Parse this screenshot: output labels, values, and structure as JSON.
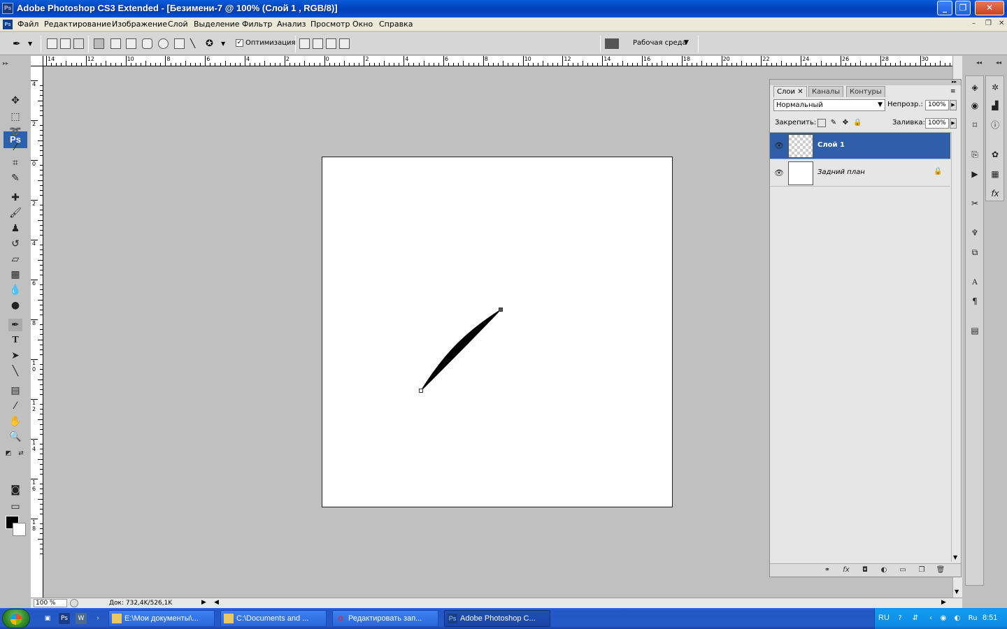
{
  "window": {
    "title": "Adobe Photoshop CS3 Extended - [Безимени-7 @ 100% (Слой 1 , RGB/8)]",
    "app_badge": "Ps"
  },
  "menu": {
    "items": [
      "Файл",
      "Редактирование",
      "Изображение",
      "Слой",
      "Выделение",
      "Фильтр",
      "Анализ",
      "Просмотр",
      "Окно",
      "Справка"
    ]
  },
  "options_bar": {
    "optimize_checked": true,
    "optimize_label": "Оптимизация",
    "workspace_label": "Рабочая среда"
  },
  "toolbox": {
    "logo": "Ps",
    "foreground_color": "#000000",
    "background_color": "#ffffff"
  },
  "rulers": {
    "horizontal_labels": [
      "14",
      "12",
      "10",
      "8",
      "6",
      "4",
      "2",
      "0",
      "2",
      "4",
      "6",
      "8",
      "10",
      "12",
      "14",
      "16",
      "18",
      "20",
      "22",
      "24",
      "26",
      "28",
      "30"
    ],
    "vertical_labels": [
      "4",
      "2",
      "0",
      "2",
      "4",
      "6",
      "8",
      "10",
      "12",
      "14",
      "16",
      "18"
    ]
  },
  "document": {
    "canvas_color": "#ffffff"
  },
  "status": {
    "zoom": "100 %",
    "doc_info": "Док: 732,4K/526,1K"
  },
  "layers_panel": {
    "tabs": [
      "Слои",
      "Каналы",
      "Контуры"
    ],
    "blend_mode": "Нормальный",
    "opacity_label": "Непрозр.:",
    "opacity_value": "100%",
    "lock_label": "Закрепить:",
    "fill_label": "Заливка:",
    "fill_value": "100%",
    "layers": [
      {
        "name": "Слой 1",
        "selected": true,
        "visible": true,
        "locked": false
      },
      {
        "name": "Задний план",
        "selected": false,
        "visible": true,
        "locked": true
      }
    ],
    "selection_color": "#2f5fa8"
  },
  "taskbar": {
    "tasks": [
      {
        "label": "E:\\Мои документы\\...",
        "icon": "folder-icon",
        "active": false
      },
      {
        "label": "C:\\Documents and ...",
        "icon": "folder-icon",
        "active": false
      },
      {
        "label": "Редактировать зап...",
        "icon": "opera-icon",
        "active": false
      },
      {
        "label": "Adobe Photoshop C...",
        "icon": "photoshop-icon",
        "active": true
      }
    ],
    "language": "RU",
    "tray_language": "Ru",
    "clock": "8:51"
  }
}
